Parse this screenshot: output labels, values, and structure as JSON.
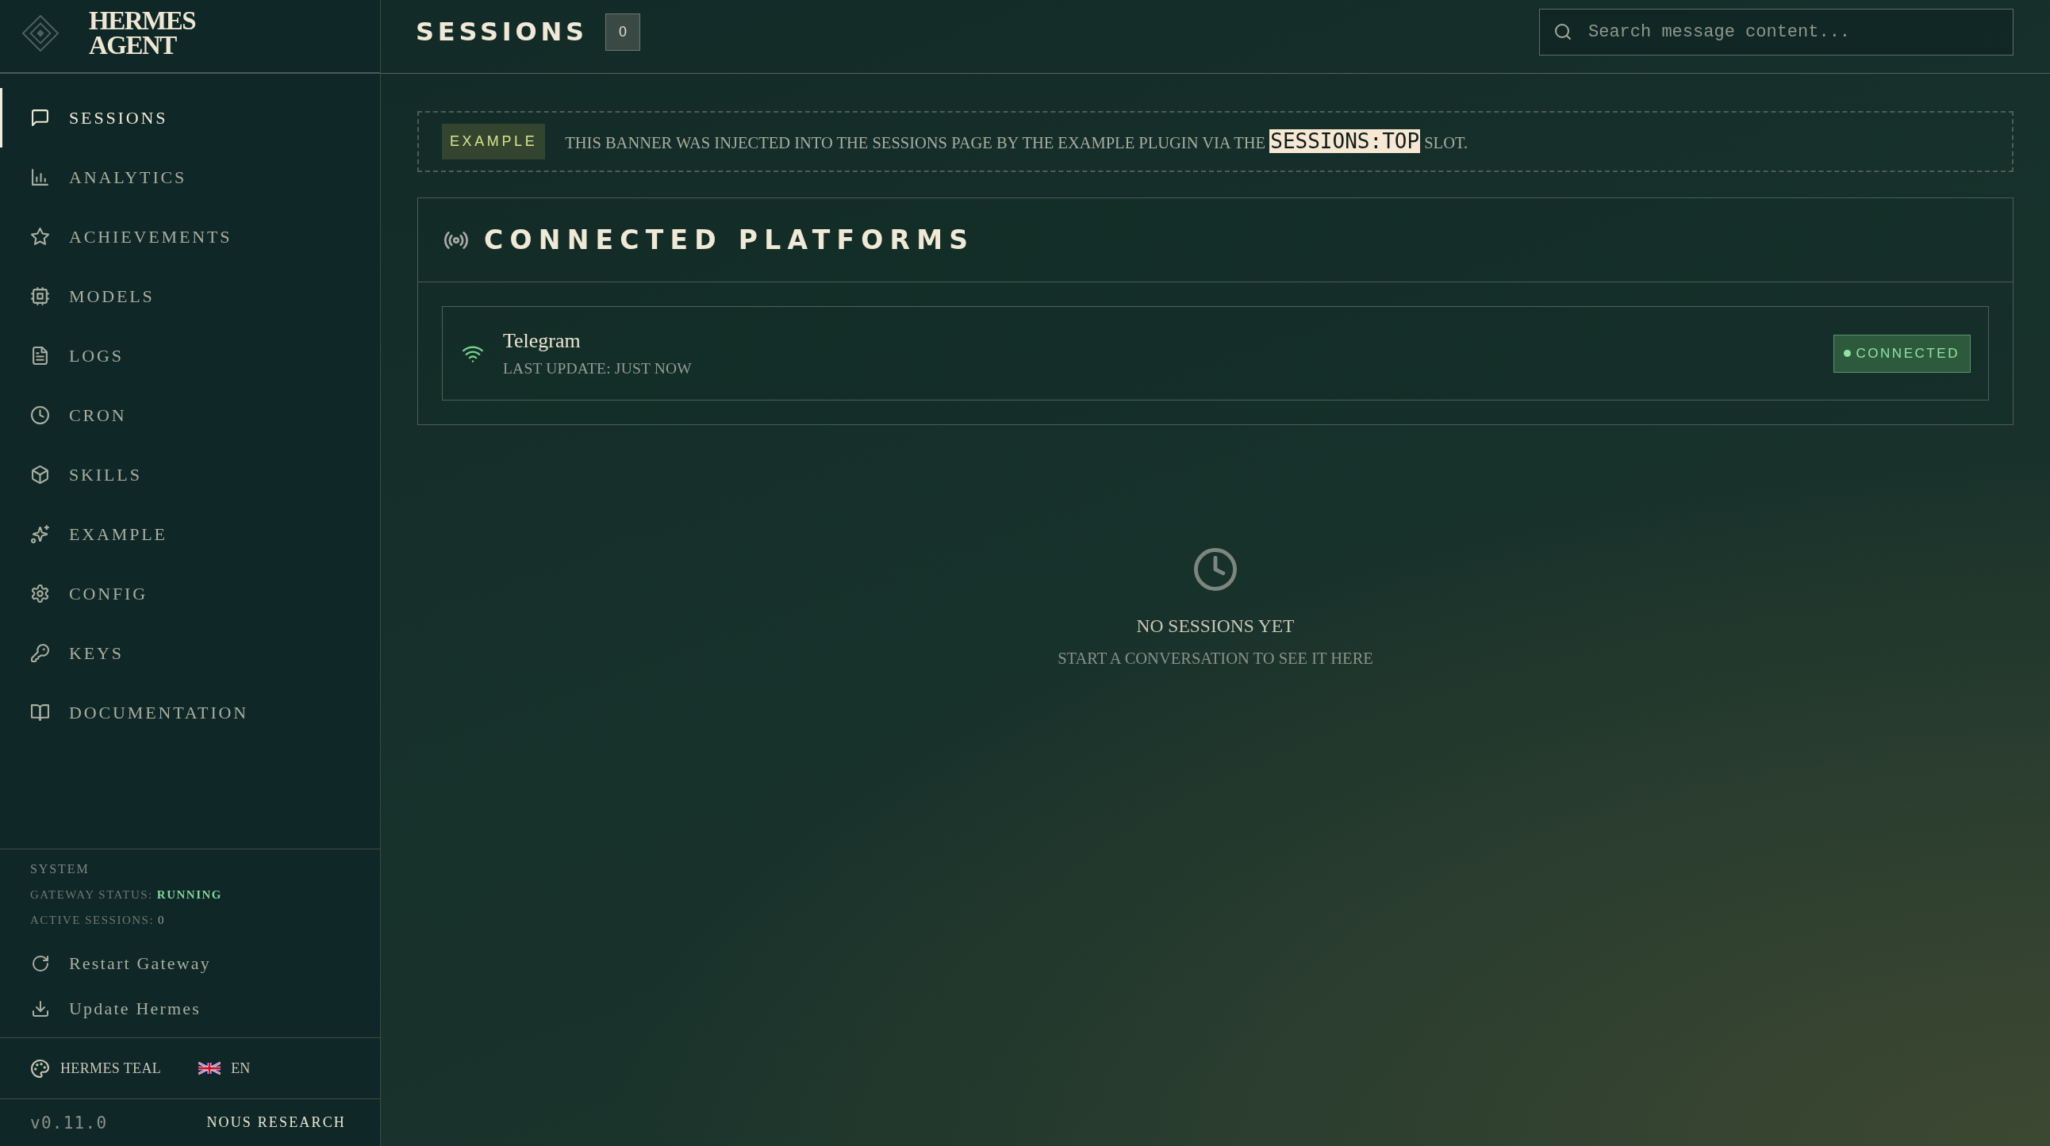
{
  "sidebar": {
    "brand": "HERMES AGENT",
    "nav": [
      {
        "label": "SESSIONS",
        "selected": true
      },
      {
        "label": "ANALYTICS",
        "selected": false
      },
      {
        "label": "ACHIEVEMENTS",
        "selected": false
      },
      {
        "label": "MODELS",
        "selected": false
      },
      {
        "label": "LOGS",
        "selected": false
      },
      {
        "label": "CRON",
        "selected": false
      },
      {
        "label": "SKILLS",
        "selected": false
      },
      {
        "label": "EXAMPLE",
        "selected": false
      },
      {
        "label": "CONFIG",
        "selected": false
      },
      {
        "label": "KEYS",
        "selected": false
      },
      {
        "label": "DOCUMENTATION",
        "selected": false
      }
    ],
    "system": {
      "heading": "SYSTEM",
      "gateway_label": "GATEWAY STATUS:",
      "gateway_status": "RUNNING",
      "gateway_running": true,
      "sessions_label": "ACTIVE SESSIONS:",
      "sessions_count": "0"
    },
    "actions": [
      {
        "label": "Restart Gateway"
      },
      {
        "label": "Update Hermes"
      }
    ],
    "theme": "HERMES TEAL",
    "language": "EN",
    "version": "v0.11.0",
    "credit": "NOUS RESEARCH"
  },
  "header": {
    "title": "SESSIONS",
    "count": "0",
    "search": {
      "placeholder": "Search message content..."
    }
  },
  "banner": {
    "tag": "EXAMPLE",
    "text": "THIS BANNER WAS INJECTED INTO THE SESSIONS PAGE BY THE EXAMPLE PLUGIN VIA THE **SESSIONS:TOP** SLOT."
  },
  "platforms": {
    "title": "CONNECTED PLATFORMS",
    "items": [
      {
        "name": "Telegram",
        "detail": "LAST UPDATE: JUST NOW",
        "status": "CONNECTED",
        "connected": true
      }
    ]
  },
  "empty_state": {
    "title": "NO SESSIONS YET",
    "subtitle": "START A CONVERSATION TO SEE IT HERE"
  }
}
